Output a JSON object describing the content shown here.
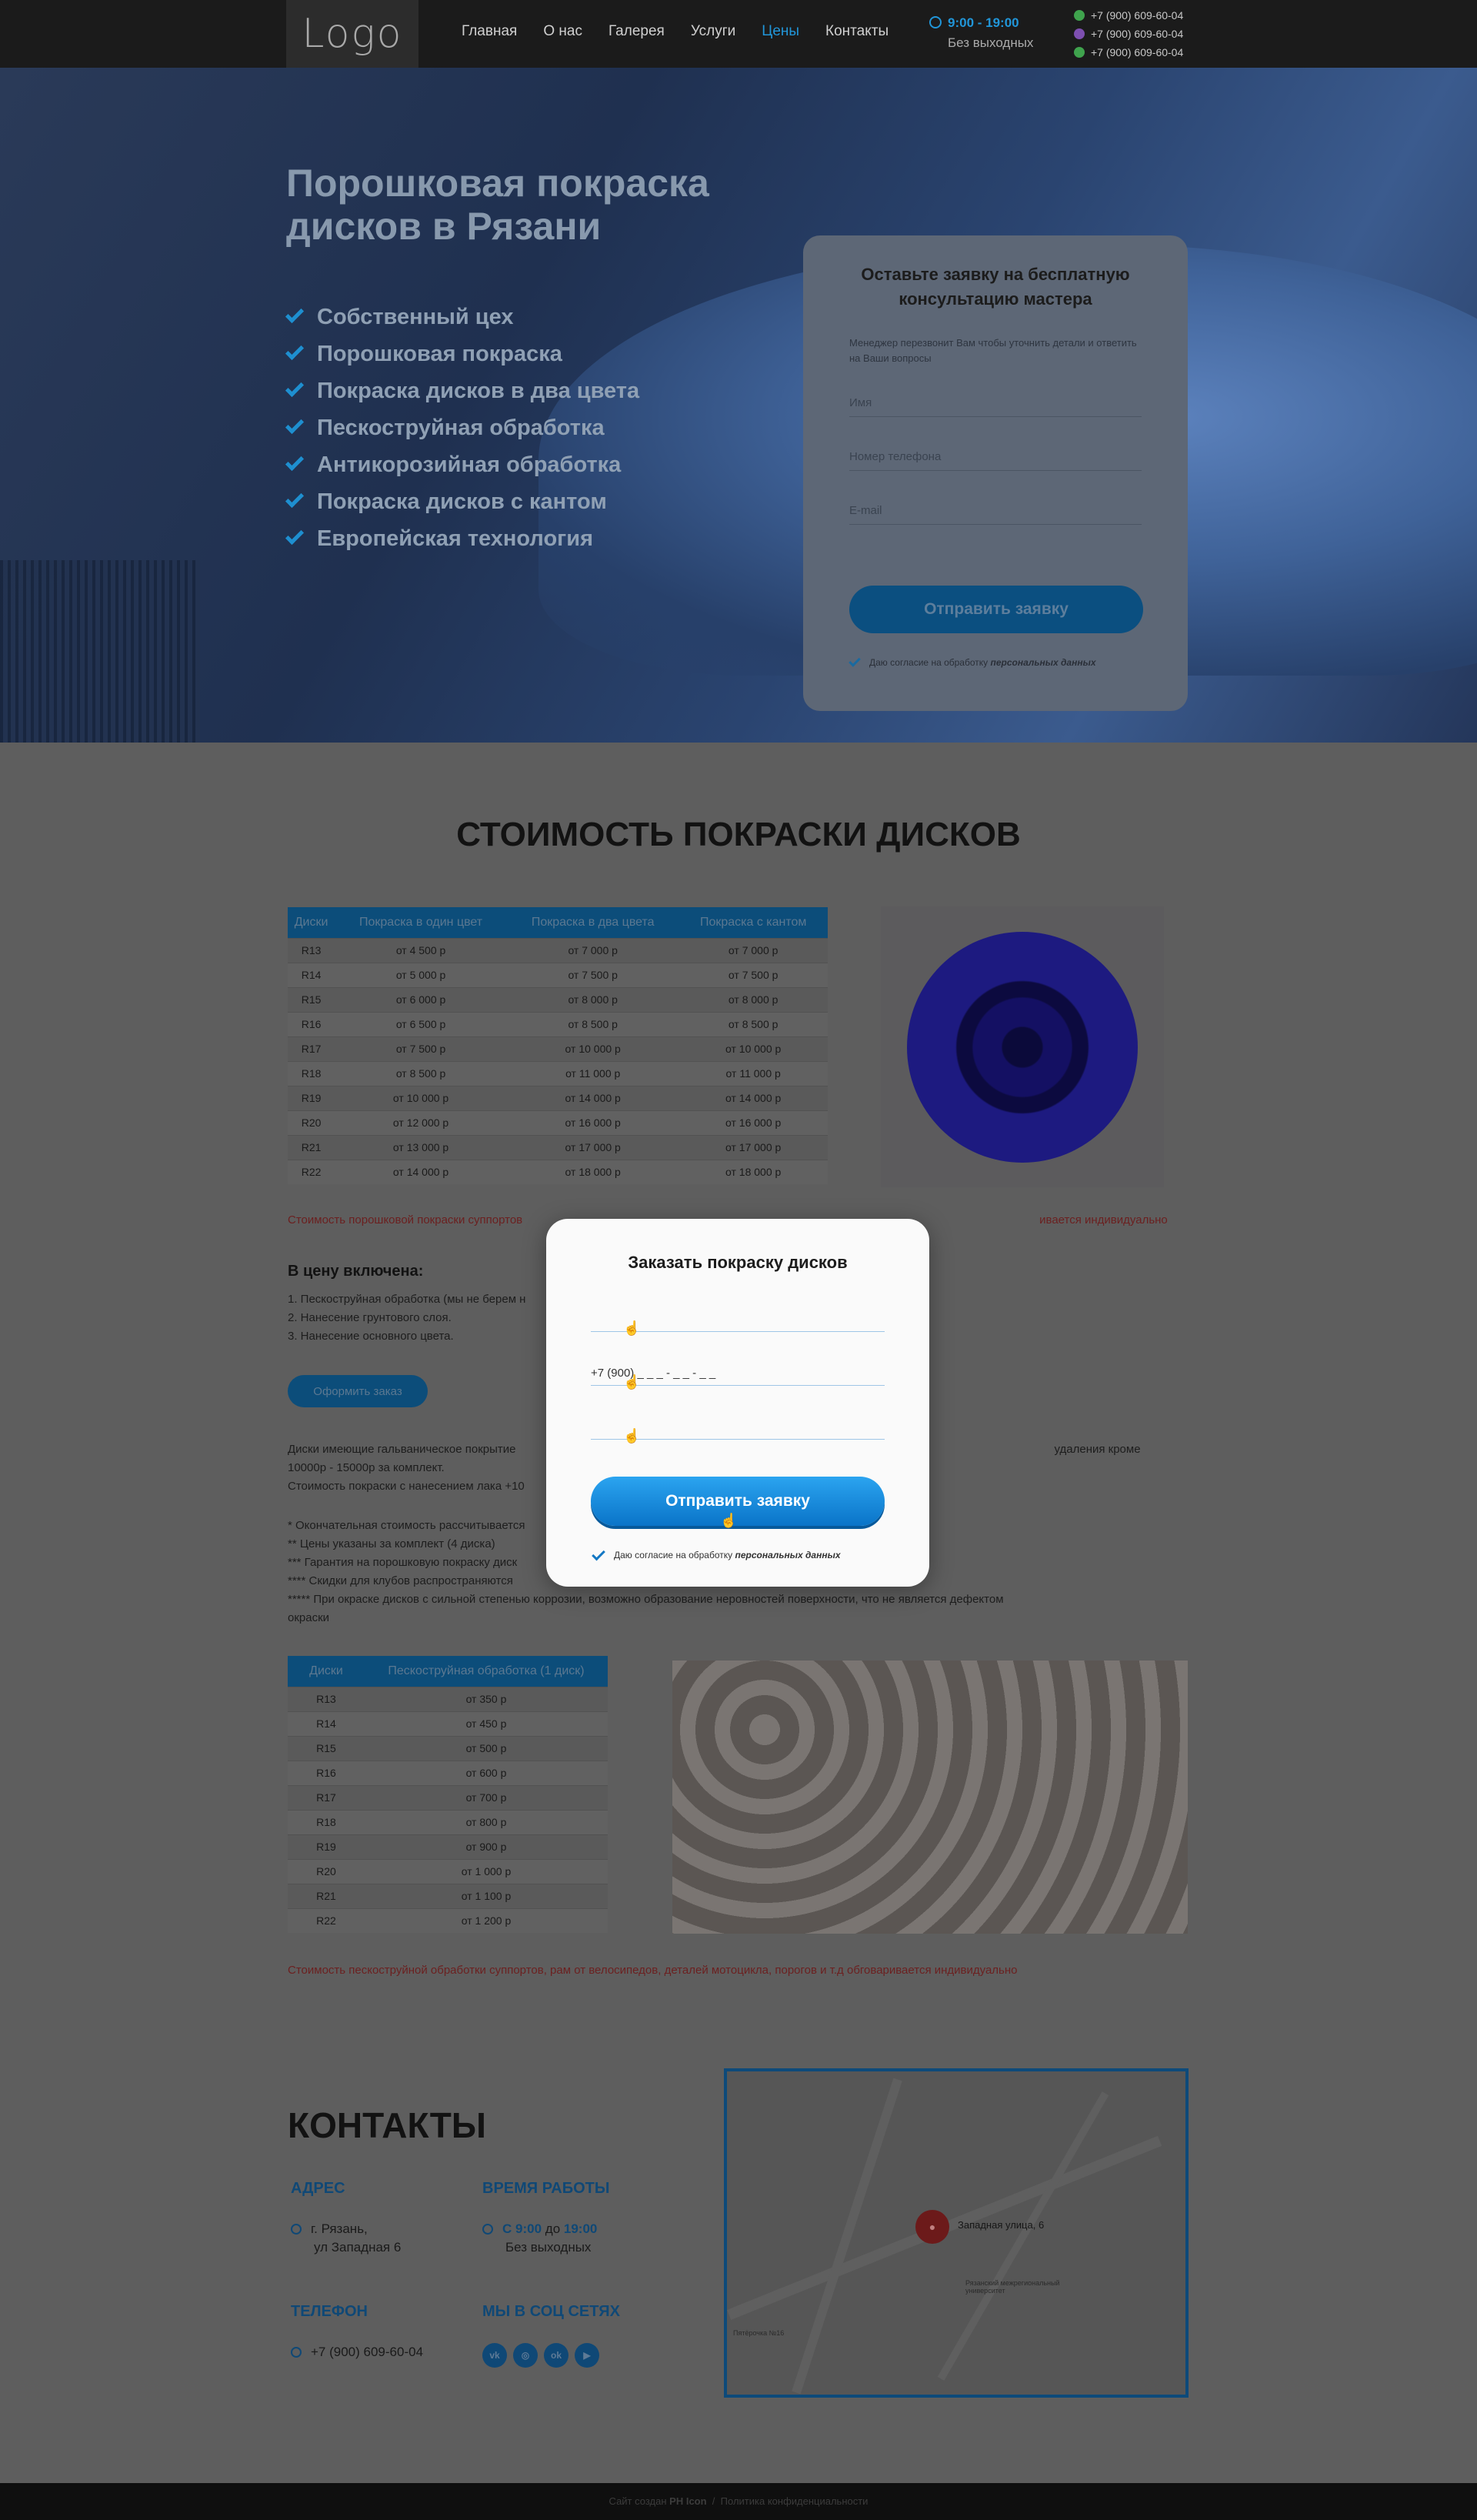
{
  "header": {
    "logo": "Logo",
    "nav": [
      "Главная",
      "О нас",
      "Галерея",
      "Услуги",
      "Цены",
      "Контакты"
    ],
    "active_nav": "Цены",
    "hours": "9:00 - 19:00",
    "hours_sub": "Без выходных",
    "phones": [
      "+7 (900) 609-60-04",
      "+7 (900) 609-60-04",
      "+7 (900) 609-60-04"
    ]
  },
  "hero": {
    "title_line1": "Порошковая покраска",
    "title_line2": "дисков в Рязани",
    "benefits": [
      "Собственный цех",
      "Порошковая покраска",
      "Покраска дисков в два цвета",
      "Пескоструйная обработка",
      "Антикорозийная обработка",
      "Покраска дисков с кантом",
      "Европейская технология"
    ],
    "form": {
      "title": "Оставьте заявку на бесплатную консультацию мастера",
      "desc": "Менеджер перезвонит Вам чтобы уточнить детали и ответить на Ваши вопросы",
      "name_ph": "Имя",
      "phone_ph": "Номер телефона",
      "email_ph": "E-mail",
      "submit": "Отправить заявку",
      "consent": "Даю согласие на обработку",
      "consent_link": "персональных данных"
    }
  },
  "prices": {
    "title": "СТОИМОСТЬ ПОКРАСКИ ДИСКОВ",
    "table1_headers": [
      "Диски",
      "Покраска в один цвет",
      "Покраска в два цвета",
      "Покраска с кантом"
    ],
    "table1_rows": [
      [
        "R13",
        "от 4 500 р",
        "от 7 000 р",
        "от 7 000 р"
      ],
      [
        "R14",
        "от 5 000 р",
        "от 7 500 р",
        "от 7 500 р"
      ],
      [
        "R15",
        "от 6 000 р",
        "от 8 000 р",
        "от 8 000 р"
      ],
      [
        "R16",
        "от 6 500 р",
        "от 8 500 р",
        "от 8 500 р"
      ],
      [
        "R17",
        "от 7 500 р",
        "от 10 000 р",
        "от 10 000 р"
      ],
      [
        "R18",
        "от 8 500 р",
        "от 11 000 р",
        "от 11 000 р"
      ],
      [
        "R19",
        "от 10 000 р",
        "от 14 000 р",
        "от 14 000 р"
      ],
      [
        "R20",
        "от 12 000 р",
        "от 16 000 р",
        "от 16 000 р"
      ],
      [
        "R21",
        "от 13 000 р",
        "от 17 000 р",
        "от 17 000 р"
      ],
      [
        "R22",
        "от 14 000 р",
        "от 18 000 р",
        "от 18 000 р"
      ]
    ],
    "note1": "Стоимость порошковой покраски суппортов",
    "note1_end": "ивается индивидуально",
    "included_title": "В цену включена:",
    "included": [
      "1. Пескоструйная обработка (мы не берем н",
      "2. Нанесение грунтового слоя.",
      "3. Нанесение основного цвета."
    ],
    "order_btn": "Оформить заказ",
    "galv_line1": "Диски имеющие гальваническое покрытие",
    "galv_line1_end": "удаления кроме",
    "galv_line2": "10000р - 15000р за комплект.",
    "galv_line3": "Стоимость покраски с нанесением лака +10",
    "footnotes": [
      "* Окончательная стоимость рассчитывается",
      "** Цены указаны за комплект (4 диска)",
      "*** Гарантия на порошковую покраску диск",
      "**** Скидки для клубов распространяются",
      "***** При окраске дисков с сильной степенью коррозии, возможно образование неровностей поверхности, что не является дефектом",
      "окраски"
    ],
    "table2_headers": [
      "Диски",
      "Пескоструйная обработка (1 диск)"
    ],
    "table2_rows": [
      [
        "R13",
        "от 350 р"
      ],
      [
        "R14",
        "от 450 р"
      ],
      [
        "R15",
        "от 500 р"
      ],
      [
        "R16",
        "от 600 р"
      ],
      [
        "R17",
        "от 700 р"
      ],
      [
        "R18",
        "от 800 р"
      ],
      [
        "R19",
        "от 900 р"
      ],
      [
        "R20",
        "от 1 000 р"
      ],
      [
        "R21",
        "от 1 100 р"
      ],
      [
        "R22",
        "от 1 200 р"
      ]
    ],
    "note2": "Стоимость пескоструйной обработки суппортов, рам от велосипедов, деталей мотоцикла, порогов и т.д обговаривается индивидуально"
  },
  "contacts": {
    "title": "КОНТАКТЫ",
    "address_h": "АДРЕС",
    "address_1": "г. Рязань,",
    "address_2": "ул Западная 6",
    "hours_h": "ВРЕМЯ РАБОТЫ",
    "hours_from": "С",
    "hours_start": "9:00",
    "hours_to": "до",
    "hours_end": "19:00",
    "hours_sub": "Без выходных",
    "phone_h": "ТЕЛЕФОН",
    "phone": "+7 (900) 609-60-04",
    "social_h": "МЫ В СОЦ СЕТЯХ",
    "socials": [
      "vk",
      "ok-icon",
      "ok",
      "yt"
    ],
    "map_label": "Западная улица, 6",
    "map_school": "Рязанский межрегиональный университет",
    "map_shop": "Пятёрочка №16"
  },
  "footer": {
    "made_by": "Сайт создан",
    "author": "PH Icon",
    "sep": "/",
    "privacy": "Политика конфиденциальности"
  },
  "modal": {
    "title": "Заказать покраску дисков",
    "phone_mask": "+7 (900) _ _ _ - _ _ - _ _",
    "submit": "Отправить заявку",
    "consent": "Даю согласие на обработку",
    "consent_link": "персональных данных"
  }
}
